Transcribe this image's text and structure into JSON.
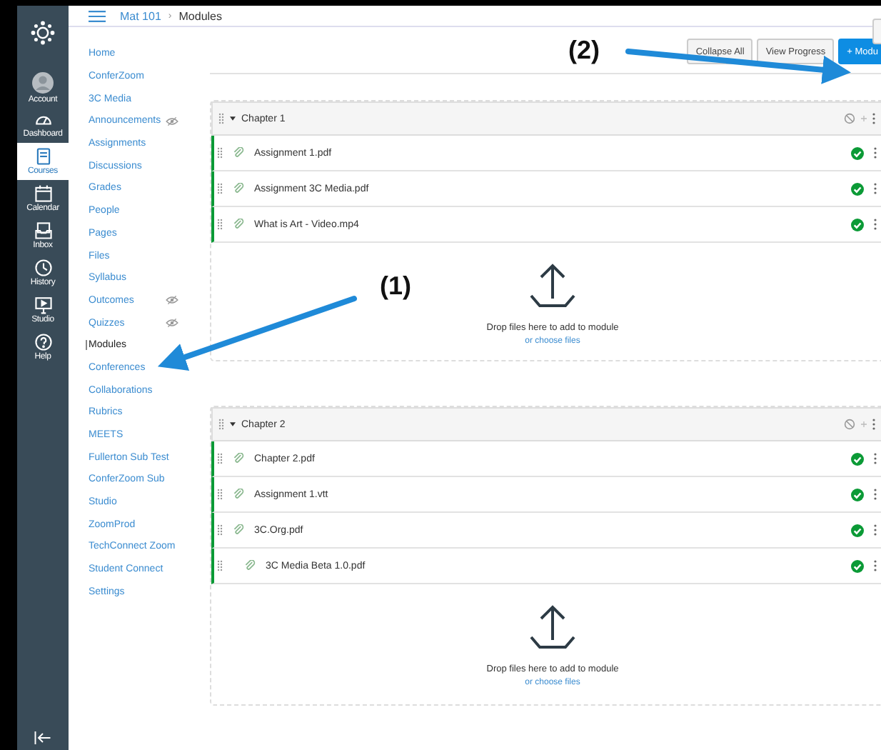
{
  "global_nav": [
    {
      "label": "Account",
      "selected": false
    },
    {
      "label": "Dashboard",
      "selected": false
    },
    {
      "label": "Courses",
      "selected": true
    },
    {
      "label": "Calendar",
      "selected": false
    },
    {
      "label": "Inbox",
      "selected": false
    },
    {
      "label": "History",
      "selected": false
    },
    {
      "label": "Studio",
      "selected": false
    },
    {
      "label": "Help",
      "selected": false
    }
  ],
  "breadcrumb": {
    "course": "Mat 101",
    "separator": "›",
    "page": "Modules"
  },
  "course_nav": [
    {
      "label": "Home",
      "selected": false,
      "hidden": false
    },
    {
      "label": "ConferZoom",
      "selected": false,
      "hidden": false
    },
    {
      "label": "3C Media",
      "selected": false,
      "hidden": false
    },
    {
      "label": "Announcements",
      "selected": false,
      "hidden": true
    },
    {
      "label": "Assignments",
      "selected": false,
      "hidden": false
    },
    {
      "label": "Discussions",
      "selected": false,
      "hidden": false
    },
    {
      "label": "Grades",
      "selected": false,
      "hidden": false
    },
    {
      "label": "People",
      "selected": false,
      "hidden": false
    },
    {
      "label": "Pages",
      "selected": false,
      "hidden": false
    },
    {
      "label": "Files",
      "selected": false,
      "hidden": false
    },
    {
      "label": "Syllabus",
      "selected": false,
      "hidden": false
    },
    {
      "label": "Outcomes",
      "selected": false,
      "hidden": true
    },
    {
      "label": "Quizzes",
      "selected": false,
      "hidden": true
    },
    {
      "label": "Modules",
      "selected": true,
      "hidden": false
    },
    {
      "label": "Conferences",
      "selected": false,
      "hidden": false
    },
    {
      "label": "Collaborations",
      "selected": false,
      "hidden": false
    },
    {
      "label": "Rubrics",
      "selected": false,
      "hidden": false
    },
    {
      "label": "MEETS",
      "selected": false,
      "hidden": false
    },
    {
      "label": "Fullerton Sub Test",
      "selected": false,
      "hidden": false
    },
    {
      "label": "ConferZoom Sub",
      "selected": false,
      "hidden": false
    },
    {
      "label": "Studio",
      "selected": false,
      "hidden": false
    },
    {
      "label": "ZoomProd",
      "selected": false,
      "hidden": false
    },
    {
      "label": "TechConnect Zoom",
      "selected": false,
      "hidden": false
    },
    {
      "label": "Student Connect",
      "selected": false,
      "hidden": false
    },
    {
      "label": "Settings",
      "selected": false,
      "hidden": false
    }
  ],
  "toolbar": {
    "buttons": [
      {
        "label": "Collapse All",
        "primary": false
      },
      {
        "label": "View Progress",
        "primary": false
      },
      {
        "label": "+ Modu",
        "primary": true
      }
    ]
  },
  "modules": [
    {
      "title": "Chapter 1",
      "expanded": true,
      "items": [
        {
          "name": "Assignment 1.pdf",
          "published": true,
          "indented": false
        },
        {
          "name": "Assignment 3C Media.pdf",
          "published": true,
          "indented": false
        },
        {
          "name": "What is Art - Video.mp4",
          "published": true,
          "indented": false
        }
      ],
      "drop_text": "Drop files here to add to module",
      "choose_link": "or choose files"
    },
    {
      "title": "Chapter 2",
      "expanded": true,
      "items": [
        {
          "name": "Chapter 2.pdf",
          "published": true,
          "indented": false
        },
        {
          "name": "Assignment 1.vtt",
          "published": true,
          "indented": false
        },
        {
          "name": "3C.Org.pdf",
          "published": true,
          "indented": false
        },
        {
          "name": "3C Media Beta 1.0.pdf",
          "published": true,
          "indented": true
        }
      ],
      "drop_text": "Drop files here to add to module",
      "choose_link": "or choose files"
    }
  ],
  "annotations": [
    "(1)",
    "(2)"
  ]
}
